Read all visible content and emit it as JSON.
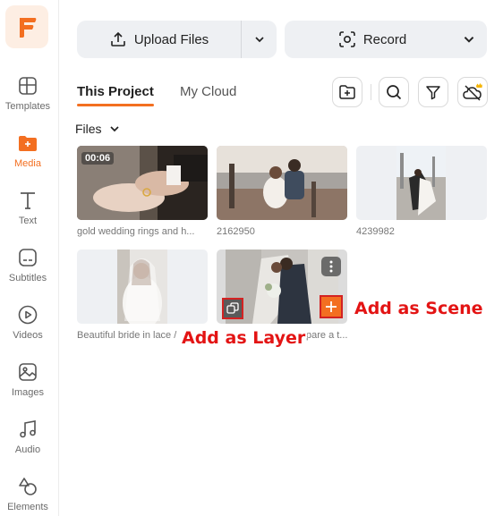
{
  "sidebar": {
    "items": [
      {
        "label": "Templates",
        "icon": "templates-icon"
      },
      {
        "label": "Media",
        "icon": "media-icon",
        "active": true
      },
      {
        "label": "Text",
        "icon": "text-icon"
      },
      {
        "label": "Subtitles",
        "icon": "subtitles-icon"
      },
      {
        "label": "Videos",
        "icon": "videos-icon"
      },
      {
        "label": "Images",
        "icon": "images-icon"
      },
      {
        "label": "Audio",
        "icon": "audio-icon"
      },
      {
        "label": "Elements",
        "icon": "elements-icon"
      }
    ]
  },
  "toolbar": {
    "upload_label": "Upload Files",
    "record_label": "Record"
  },
  "tabs": [
    {
      "label": "This Project",
      "active": true
    },
    {
      "label": "My Cloud",
      "active": false
    }
  ],
  "files_label": "Files",
  "media": [
    {
      "caption": "gold wedding rings and h...",
      "duration": "00:06"
    },
    {
      "caption": "2162950"
    },
    {
      "caption": "4239982"
    },
    {
      "caption": "Beautiful bride in lace /"
    },
    {
      "caption": "pare a t..."
    }
  ],
  "callouts": {
    "scene": "Add as Scene",
    "layer": "Add as Layer"
  },
  "colors": {
    "accent": "#f36f21",
    "callout": "#e31414",
    "button_bg": "#eef0f3"
  }
}
